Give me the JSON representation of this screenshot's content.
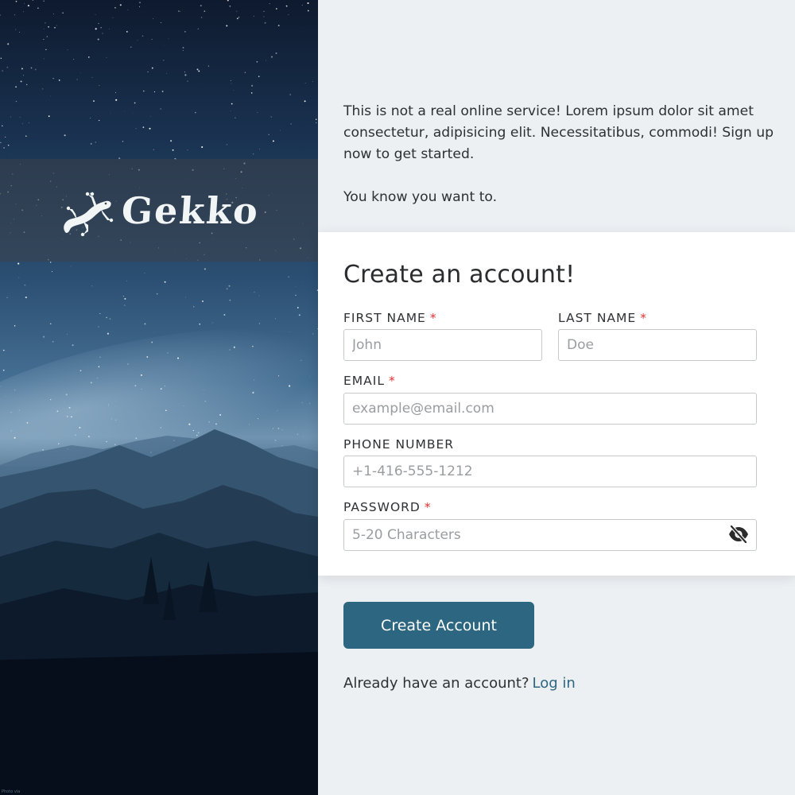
{
  "brand": {
    "name": "Gekko",
    "logo_icon": "gecko-icon",
    "credit": "Photo via"
  },
  "intro": {
    "paragraph1": "This is not a real online service! Lorem ipsum dolor sit amet consectetur, adipisicing elit. Necessitatibus, commodi! Sign up now to get started.",
    "paragraph2": "You know you want to."
  },
  "form": {
    "title": "Create an account!",
    "required_mark": "*",
    "first_name": {
      "label": "FIRST NAME",
      "placeholder": "John",
      "value": ""
    },
    "last_name": {
      "label": "LAST NAME",
      "placeholder": "Doe",
      "value": ""
    },
    "email": {
      "label": "EMAIL",
      "placeholder": "example@email.com",
      "value": ""
    },
    "phone": {
      "label": "PHONE NUMBER",
      "placeholder": "+1-416-555-1212",
      "value": ""
    },
    "password": {
      "label": "PASSWORD",
      "placeholder": "5-20 Characters",
      "value": "",
      "toggle_icon": "eye-slash-icon"
    }
  },
  "actions": {
    "create_label": "Create Account",
    "login_prompt": "Already have an account?",
    "login_link": "Log in"
  },
  "colors": {
    "accent": "#2d6680",
    "required": "#e03030",
    "page_bg": "#ecf0f3",
    "card_bg": "#ffffff"
  }
}
